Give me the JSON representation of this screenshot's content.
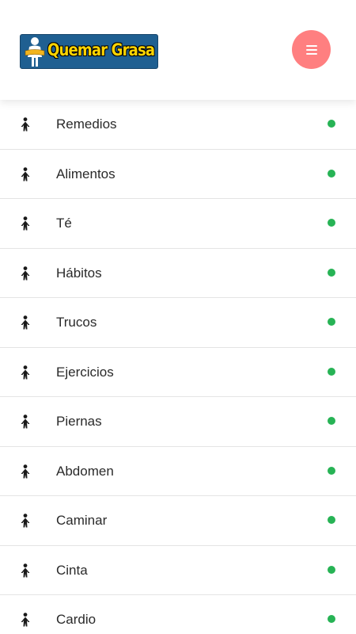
{
  "header": {
    "logo_text": "Quemar Grasa",
    "menu_icon": "hamburger-menu-icon",
    "menu_button_color": "#ff7f80"
  },
  "nav": {
    "item_icon": "person-figure-icon",
    "status_dot_color": "#27b355",
    "items": [
      {
        "label": "Remedios"
      },
      {
        "label": "Alimentos"
      },
      {
        "label": "Té"
      },
      {
        "label": "Hábitos"
      },
      {
        "label": "Trucos"
      },
      {
        "label": "Ejercicios"
      },
      {
        "label": "Piernas"
      },
      {
        "label": "Abdomen"
      },
      {
        "label": "Caminar"
      },
      {
        "label": "Cinta"
      },
      {
        "label": "Cardio"
      }
    ]
  }
}
